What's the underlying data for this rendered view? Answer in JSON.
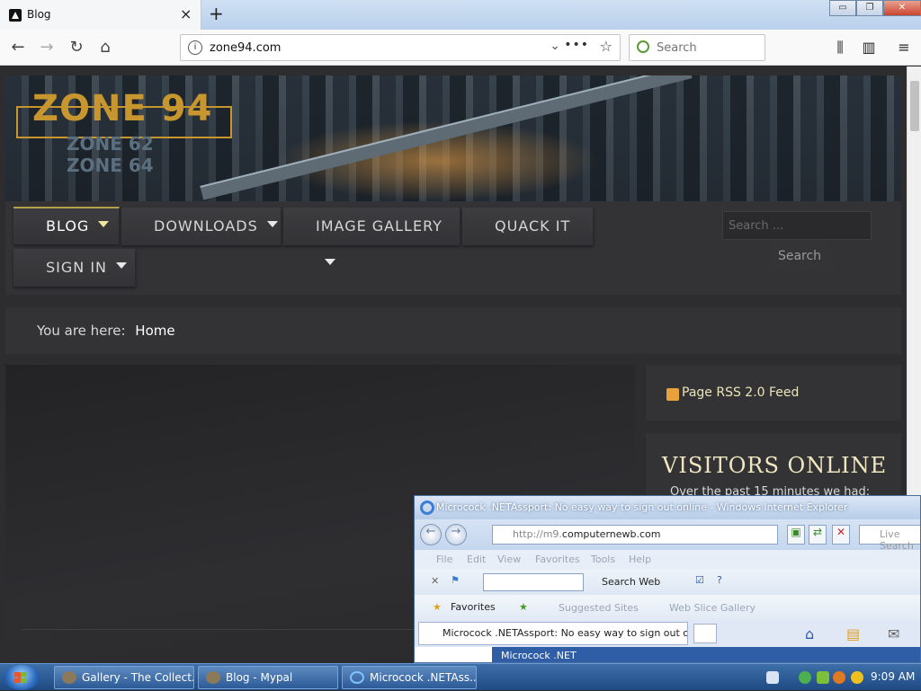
{
  "browser": {
    "tab_title": "Blog",
    "tab_close": "×",
    "new_tab": "+",
    "url": "zone94.com",
    "search_placeholder": "Search",
    "window_buttons": {
      "minimize": "▭",
      "maximize": "❐",
      "close": "✕"
    }
  },
  "site": {
    "logo": {
      "main": "ZONE 94",
      "line2": "ZONE 62",
      "line3": "ZONE 64"
    },
    "menu": [
      {
        "label": "BLOG",
        "has_caret": true
      },
      {
        "label": "DOWNLOADS",
        "has_caret": true
      },
      {
        "label": "IMAGE GALLERY",
        "has_caret": true
      },
      {
        "label": "QUACK IT",
        "has_caret": false
      },
      {
        "label": "SIGN IN",
        "has_caret": true
      }
    ],
    "search_placeholder": "Search ...",
    "search_button": "Search",
    "breadcrumb_prefix": "You are here:",
    "breadcrumb_home": "Home",
    "rss_label": "Page RSS 2.0 Feed",
    "visitors_heading": "VISITORS ONLINE",
    "visitors_text": "Over the past 15 minutes we had:"
  },
  "ie_window": {
    "title": "Microcock .NETAssport: No easy way to sign out online - Windows Internet Explorer",
    "url_prefix": "http://m9.",
    "url_domain": "computernewb.com",
    "live_search": "Live Search",
    "menu": [
      "File",
      "Edit",
      "View",
      "Favorites",
      "Tools",
      "Help"
    ],
    "search_web": "Search Web",
    "favorites": "Favorites",
    "suggested_sites": "Suggested Sites",
    "web_slice_gallery": "Web Slice Gallery",
    "tab_title": "Microcock .NETAssport: No easy way to sign out o...",
    "content_text": "Microcock .NET"
  },
  "taskbar": {
    "buttons": [
      {
        "label": "Gallery - The Collect..."
      },
      {
        "label": "Blog - Mypal"
      },
      {
        "label": "Microcock .NETAss..."
      }
    ],
    "clock": "9:09 AM"
  }
}
